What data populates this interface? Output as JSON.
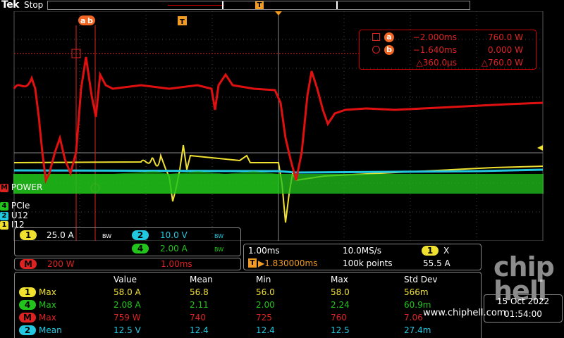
{
  "header": {
    "brand": "Tek",
    "run_state": "Stop"
  },
  "colors": {
    "ch1": "#f0e130",
    "ch2": "#22c8e0",
    "ch4": "#22c41c",
    "math": "#e01010",
    "cursor": "#d22"
  },
  "screen": {
    "cursor_a_tag": "a",
    "cursor_b_tag": "b",
    "trigger_tag": "T"
  },
  "cursors": {
    "a": {
      "tag": "a",
      "time": "−2.000ms",
      "value": "760.0 W"
    },
    "b": {
      "tag": "b",
      "time": "−1.640ms",
      "value": "0.000 W"
    },
    "delta": {
      "time": "△360.0μs",
      "value": "△760.0 W"
    }
  },
  "channel_labels": {
    "math": {
      "num": "M",
      "label": "POWER"
    },
    "ch4": {
      "num": "4",
      "label": "PCIe"
    },
    "ch2": {
      "num": "2",
      "label": "U12"
    },
    "ch1": {
      "num": "1",
      "label": "I12"
    }
  },
  "scales": {
    "ch1": {
      "num": "1",
      "value": "25.0 A",
      "bw": "BW"
    },
    "ch2": {
      "num": "2",
      "value": "10.0 V",
      "bw": "BW"
    },
    "ch4": {
      "num": "4",
      "value": "2.00 A",
      "bw": "BW"
    },
    "math": {
      "num": "M",
      "value": "200 W",
      "time": "1.00ms"
    }
  },
  "horizontal": {
    "timebase": "1.00ms",
    "sample_rate": "10.0MS/s",
    "trigger_source": "1",
    "trigger_symbol": "X",
    "trigger_level": "55.5 A",
    "trigger_pos": "▶1.830000ms",
    "record_length": "100k points"
  },
  "measurements": {
    "headers": [
      "Value",
      "Mean",
      "Min",
      "Max",
      "Std Dev"
    ],
    "rows": [
      {
        "ch": "1",
        "name": "Max",
        "values": [
          "58.0 A",
          "56.8",
          "56.0",
          "58.0",
          "566m"
        ]
      },
      {
        "ch": "4",
        "name": "Max",
        "values": [
          "2.08 A",
          "2.11",
          "2.00",
          "2.24",
          "60.9m"
        ]
      },
      {
        "ch": "M",
        "name": "Max",
        "values": [
          "759 W",
          "740",
          "725",
          "760",
          "7.06"
        ]
      },
      {
        "ch": "2",
        "name": "Mean",
        "values": [
          "12.5 V",
          "12.4",
          "12.4",
          "12.5",
          "27.4m"
        ]
      }
    ]
  },
  "footer": {
    "website": "www.chiphell.com",
    "date": "15 Oct 2022",
    "time": "01:54:00"
  },
  "watermark": {
    "line1": "chip",
    "line2": "hell"
  }
}
